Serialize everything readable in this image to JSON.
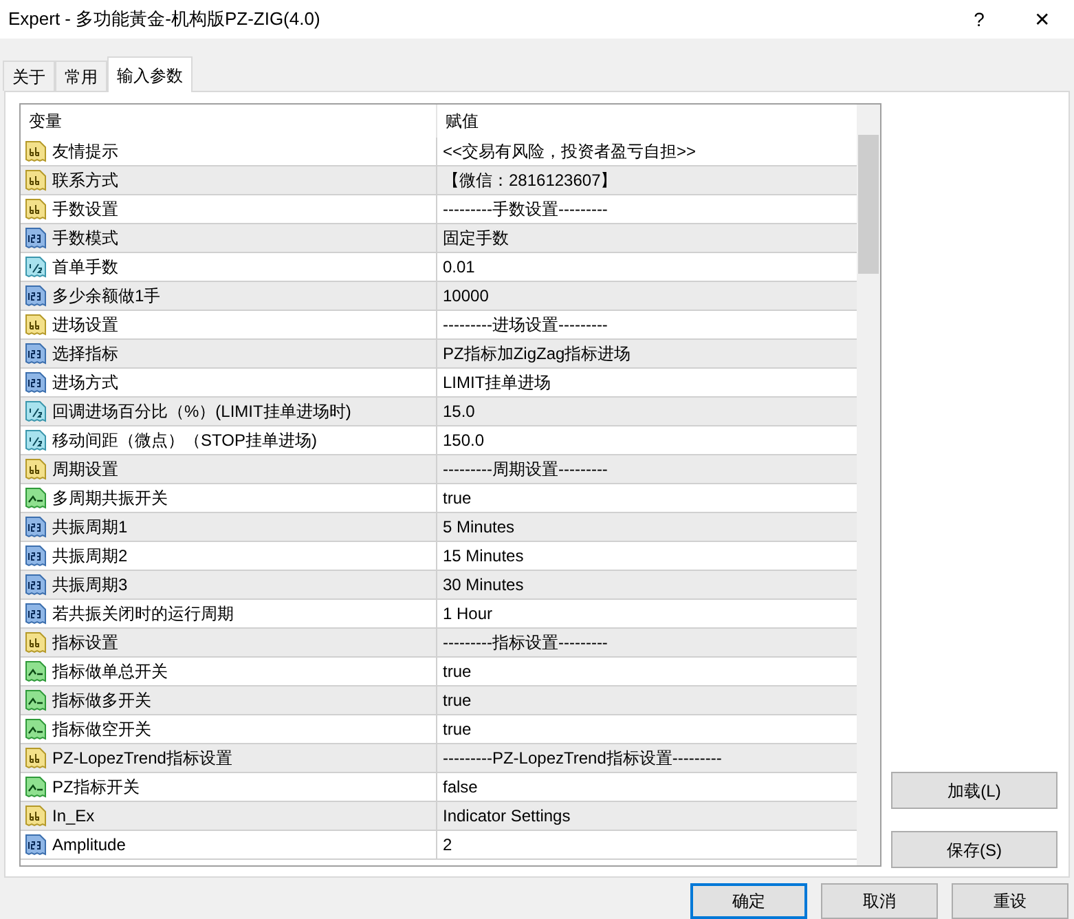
{
  "window": {
    "title": "Expert - 多功能黃金-机构版PZ-ZIG(4.0)",
    "help": "?",
    "close": "✕"
  },
  "tabs": [
    {
      "label": "关于",
      "selected": false
    },
    {
      "label": "常用",
      "selected": false
    },
    {
      "label": "输入参数",
      "selected": true
    }
  ],
  "table": {
    "columns": [
      "变量",
      "赋值"
    ],
    "rows": [
      {
        "kind": "string",
        "name": "友情提示",
        "value": "<<交易有风险，投资者盈亏自担>>"
      },
      {
        "kind": "string",
        "name": "联系方式",
        "value": "【微信：2816123607】"
      },
      {
        "kind": "string",
        "name": "手数设置",
        "value": "---------手数设置---------"
      },
      {
        "kind": "integer",
        "name": "手数模式",
        "value": "固定手数"
      },
      {
        "kind": "double",
        "name": "首单手数",
        "value": "0.01"
      },
      {
        "kind": "integer",
        "name": "多少余额做1手",
        "value": "10000"
      },
      {
        "kind": "string",
        "name": "进场设置",
        "value": "---------进场设置---------"
      },
      {
        "kind": "integer",
        "name": "选择指标",
        "value": "PZ指标加ZigZag指标进场"
      },
      {
        "kind": "integer",
        "name": "进场方式",
        "value": "LIMIT挂单进场"
      },
      {
        "kind": "double",
        "name": "回调进场百分比（%）(LIMIT挂单进场时)",
        "value": "15.0"
      },
      {
        "kind": "double",
        "name": "移动间距（微点）（STOP挂单进场)",
        "value": "150.0"
      },
      {
        "kind": "string",
        "name": "周期设置",
        "value": "---------周期设置---------"
      },
      {
        "kind": "bool",
        "name": "多周期共振开关",
        "value": "true"
      },
      {
        "kind": "integer",
        "name": "共振周期1",
        "value": "5 Minutes"
      },
      {
        "kind": "integer",
        "name": "共振周期2",
        "value": "15 Minutes"
      },
      {
        "kind": "integer",
        "name": "共振周期3",
        "value": "30 Minutes"
      },
      {
        "kind": "integer",
        "name": "若共振关闭时的运行周期",
        "value": "1 Hour"
      },
      {
        "kind": "string",
        "name": "指标设置",
        "value": "---------指标设置---------"
      },
      {
        "kind": "bool",
        "name": "指标做单总开关",
        "value": "true"
      },
      {
        "kind": "bool",
        "name": "指标做多开关",
        "value": "true"
      },
      {
        "kind": "bool",
        "name": "指标做空开关",
        "value": "true"
      },
      {
        "kind": "string",
        "name": "PZ-LopezTrend指标设置",
        "value": "---------PZ-LopezTrend指标设置---------"
      },
      {
        "kind": "bool",
        "name": "PZ指标开关",
        "value": "false"
      },
      {
        "kind": "string",
        "name": "In_Ex",
        "value": "Indicator Settings"
      },
      {
        "kind": "integer",
        "name": "Amplitude",
        "value": "2"
      }
    ]
  },
  "side_buttons": [
    "加载(L)",
    "保存(S)"
  ],
  "buttons": [
    {
      "label": "确定",
      "default": true
    },
    {
      "label": "取消",
      "default": false
    },
    {
      "label": "重设",
      "default": false
    }
  ]
}
